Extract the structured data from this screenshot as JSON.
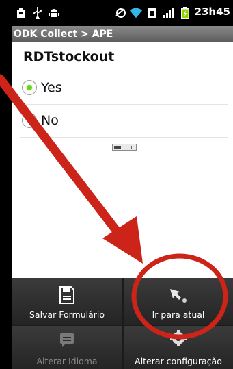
{
  "statusbar": {
    "time": "23h45",
    "icons": [
      "notification-icon",
      "usb-icon",
      "android-debug-icon",
      "alarm-icon",
      "wifi-icon",
      "sim-icon",
      "signal-icon",
      "battery-icon"
    ]
  },
  "titlebar": {
    "title": "ODK Collect > APE"
  },
  "form": {
    "question": "RDTstockout",
    "options": [
      {
        "label": "Yes",
        "selected": true
      },
      {
        "label": "No",
        "selected": false
      }
    ]
  },
  "menu": {
    "items": [
      {
        "label": "Salvar Formulário",
        "icon": "save-icon",
        "enabled": true
      },
      {
        "label": "Ir para atual",
        "icon": "go-to-current-icon",
        "enabled": true
      },
      {
        "label": "Alterar Idioma",
        "icon": "language-icon",
        "enabled": false
      },
      {
        "label": "Alterar configuração",
        "icon": "settings-icon",
        "enabled": true
      }
    ]
  },
  "annotation": {
    "color": "#cc2418"
  },
  "colors": {
    "radio_selected": "#6fcf2a",
    "titlebar": "#777777",
    "menu_background": "#2a2a2a"
  }
}
